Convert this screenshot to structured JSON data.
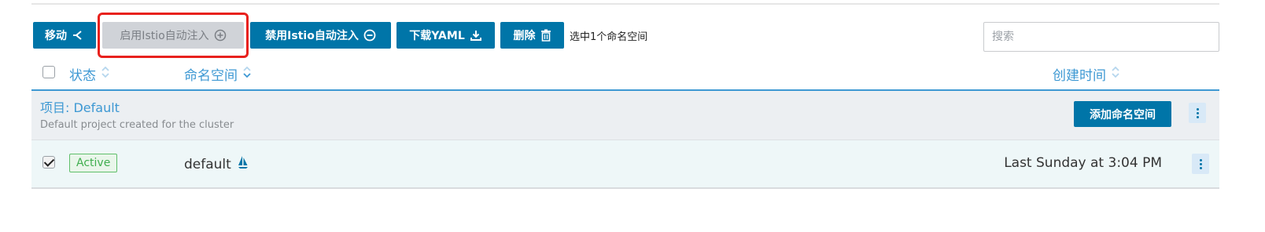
{
  "toolbar": {
    "move_label": "移动",
    "enable_istio_label": "启用Istio自动注入",
    "disable_istio_label": "禁用Istio自动注入",
    "download_yaml_label": "下载YAML",
    "delete_label": "删除",
    "selection_text": "选中1个命名空间"
  },
  "search": {
    "placeholder": "搜索",
    "value": ""
  },
  "table": {
    "columns": {
      "state": "状态",
      "namespace": "命名空间",
      "created": "创建时间"
    }
  },
  "group": {
    "title": "项目: Default",
    "description": "Default project created for the cluster",
    "add_button": "添加命名空间"
  },
  "rows": [
    {
      "state": "Active",
      "namespace": "default",
      "created": "Last Sunday at 3:04 PM",
      "checked": true
    }
  ],
  "colors": {
    "primary": "#0075a8",
    "link": "#3d98d3",
    "active_green": "#3fae4e",
    "highlight_red": "#e8211d",
    "disabled": "#d0d3d8"
  },
  "icons": {
    "move": "move-icon",
    "enable": "plus-circle-icon",
    "disable": "minus-circle-icon",
    "download": "download-icon",
    "delete": "trash-icon",
    "sort": "sort-icon",
    "istio": "sail-icon",
    "menu": "kebab-menu-icon"
  }
}
